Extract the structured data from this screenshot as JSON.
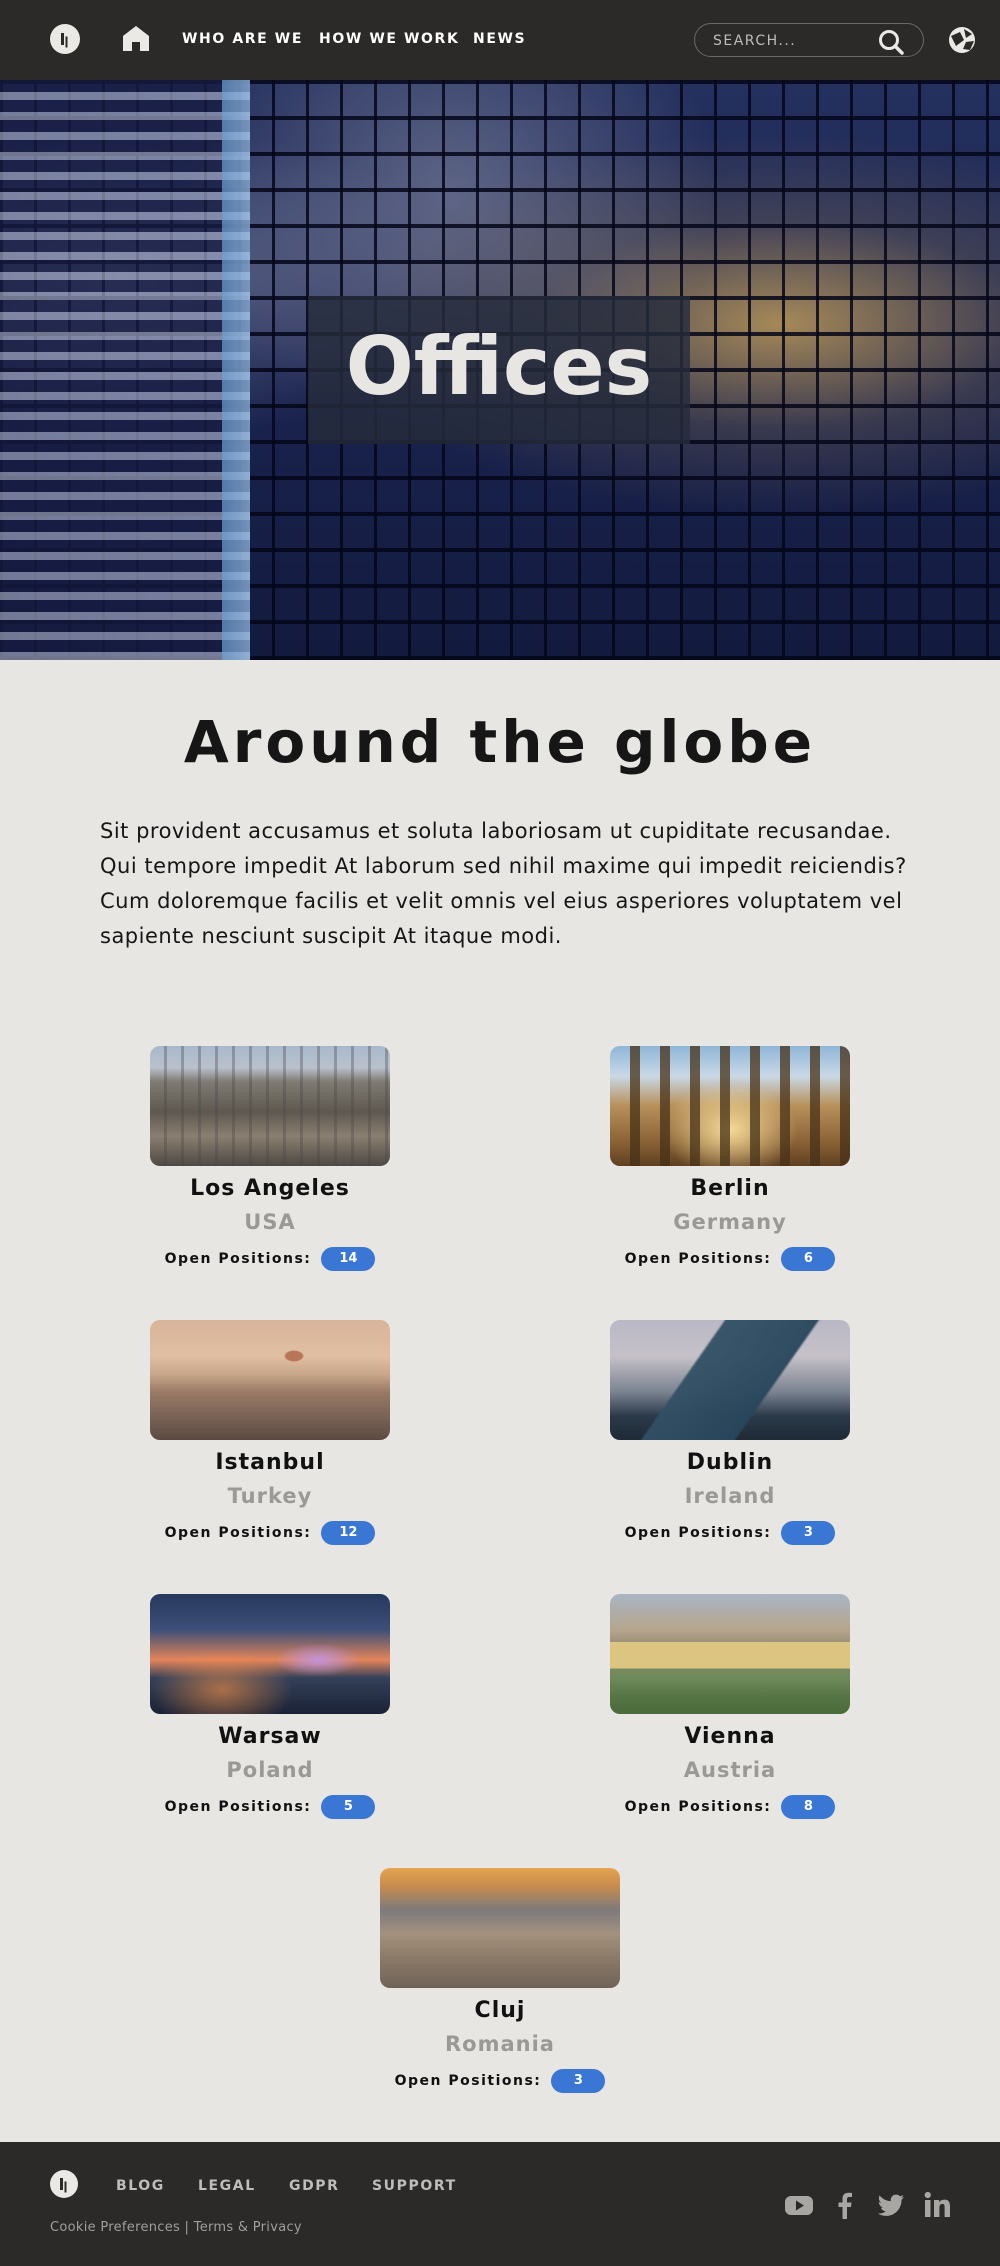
{
  "nav": {
    "links": [
      "WHO ARE WE",
      "HOW WE WORK",
      "NEWS"
    ],
    "search_placeholder": "SEARCH..."
  },
  "hero": {
    "title": "Offices"
  },
  "main": {
    "heading": "Around the globe",
    "intro": "Sit provident accusamus et soluta laboriosam ut cupiditate recusandae. Qui tempore impedit At laborum sed nihil maxime qui impedit reiciendis? Cum doloremque facilis et velit omnis vel eius asperiores voluptatem vel sapiente nesciunt suscipit At itaque modi.",
    "open_positions_label": "Open Positions:"
  },
  "offices": [
    {
      "city": "Los Angeles",
      "country": "USA",
      "open": "14"
    },
    {
      "city": "Berlin",
      "country": "Germany",
      "open": "6"
    },
    {
      "city": "Istanbul",
      "country": "Turkey",
      "open": "12"
    },
    {
      "city": "Dublin",
      "country": "Ireland",
      "open": "3"
    },
    {
      "city": "Warsaw",
      "country": "Poland",
      "open": "5"
    },
    {
      "city": "Vienna",
      "country": "Austria",
      "open": "8"
    },
    {
      "city": "Cluj",
      "country": "Romania",
      "open": "3"
    }
  ],
  "footer": {
    "links": [
      "BLOG",
      "LEGAL",
      "GDPR",
      "SUPPORT"
    ],
    "cookie": "Cookie Preferences",
    "separator": " | ",
    "terms": "Terms & Privacy",
    "social": [
      "youtube-icon",
      "facebook-icon",
      "twitter-icon",
      "linkedin-icon"
    ]
  },
  "colors": {
    "nav_bg": "#2b2a28",
    "page_bg": "#e8e6e3",
    "badge": "#3a76d4",
    "country_text": "#9b9996"
  }
}
